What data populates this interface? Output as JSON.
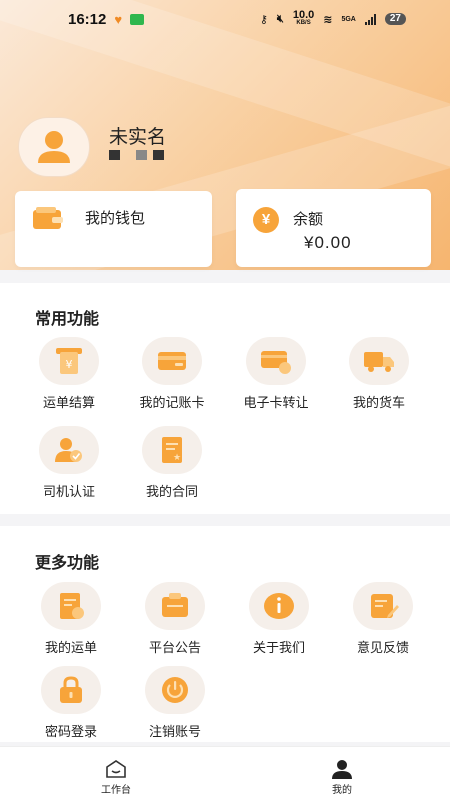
{
  "status_bar": {
    "time": "16:12",
    "net_speed": "10.0",
    "net_unit": "KB/S",
    "network": "5GA",
    "battery": "27"
  },
  "profile": {
    "name": "未实名"
  },
  "wallet": {
    "label": "我的钱包"
  },
  "balance": {
    "label": "余额",
    "symbol": "¥",
    "value": "¥0.00"
  },
  "common_functions": {
    "title": "常用功能",
    "items": [
      {
        "label": "运单结算",
        "icon": "waybill-settlement-icon"
      },
      {
        "label": "我的记账卡",
        "icon": "bank-card-icon"
      },
      {
        "label": "电子卡转让",
        "icon": "card-transfer-icon"
      },
      {
        "label": "我的货车",
        "icon": "truck-icon"
      },
      {
        "label": "司机认证",
        "icon": "driver-verify-icon"
      },
      {
        "label": "我的合同",
        "icon": "contract-icon"
      }
    ]
  },
  "more_functions": {
    "title": "更多功能",
    "items": [
      {
        "label": "我的运单",
        "icon": "waybill-icon"
      },
      {
        "label": "平台公告",
        "icon": "announcement-icon"
      },
      {
        "label": "关于我们",
        "icon": "info-icon"
      },
      {
        "label": "意见反馈",
        "icon": "feedback-icon"
      },
      {
        "label": "密码登录",
        "icon": "lock-icon"
      },
      {
        "label": "注销账号",
        "icon": "power-icon"
      }
    ]
  },
  "tab_bar": {
    "work": "工作台",
    "mine": "我的"
  },
  "colors": {
    "accent": "#f7a43a",
    "accent_light": "#fbc77c",
    "icon_bg": "#f5efea"
  }
}
